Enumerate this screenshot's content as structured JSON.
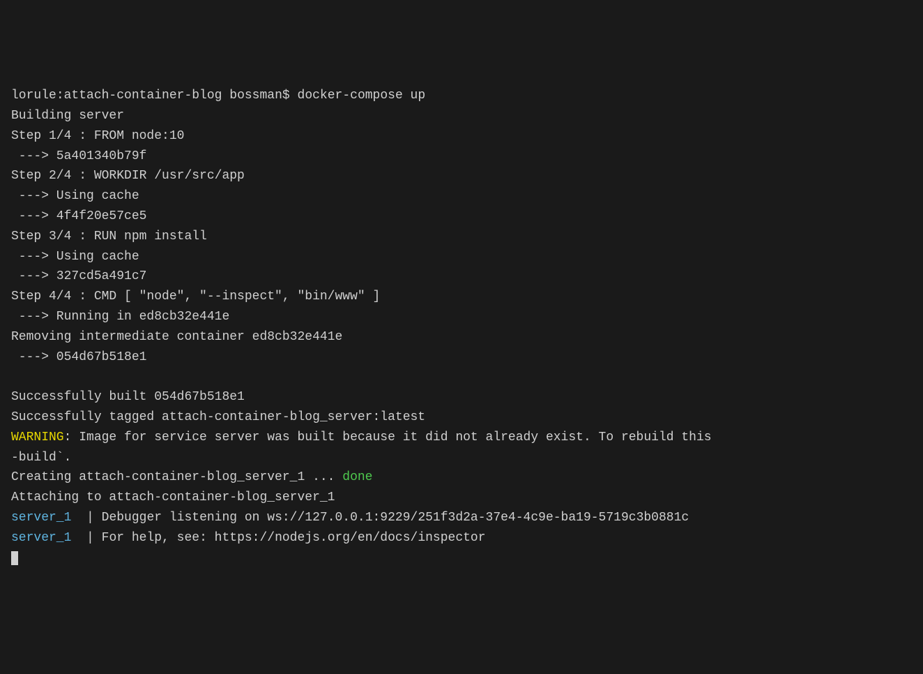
{
  "prompt": {
    "host": "lorule",
    "path": "attach-container-blog",
    "user": "bossman",
    "symbol": "$",
    "command": "docker-compose up"
  },
  "build": {
    "header": "Building server",
    "step1": {
      "label": "Step 1/4 : FROM node:10",
      "result": " ---> 5a401340b79f"
    },
    "step2": {
      "label": "Step 2/4 : WORKDIR /usr/src/app",
      "cache": " ---> Using cache",
      "result": " ---> 4f4f20e57ce5"
    },
    "step3": {
      "label": "Step 3/4 : RUN npm install",
      "cache": " ---> Using cache",
      "result": " ---> 327cd5a491c7"
    },
    "step4": {
      "label": "Step 4/4 : CMD [ \"node\", \"--inspect\", \"bin/www\" ]",
      "running": " ---> Running in ed8cb32e441e",
      "removing": "Removing intermediate container ed8cb32e441e",
      "result": " ---> 054d67b518e1"
    }
  },
  "success": {
    "built": "Successfully built 054d67b518e1",
    "tagged": "Successfully tagged attach-container-blog_server:latest"
  },
  "warning": {
    "prefix": "WARNING",
    "message": ": Image for service server was built because it did not already exist. To rebuild this ",
    "continuation": "-build`."
  },
  "creating": {
    "prefix": "Creating attach-container-blog_server_1 ... ",
    "status": "done"
  },
  "attaching": "Attaching to attach-container-blog_server_1",
  "logs": {
    "line1": {
      "service": "server_1",
      "sep": "  | ",
      "message": "Debugger listening on ws://127.0.0.1:9229/251f3d2a-37e4-4c9e-ba19-5719c3b0881c"
    },
    "line2": {
      "service": "server_1",
      "sep": "  | ",
      "message": "For help, see: https://nodejs.org/en/docs/inspector"
    }
  }
}
